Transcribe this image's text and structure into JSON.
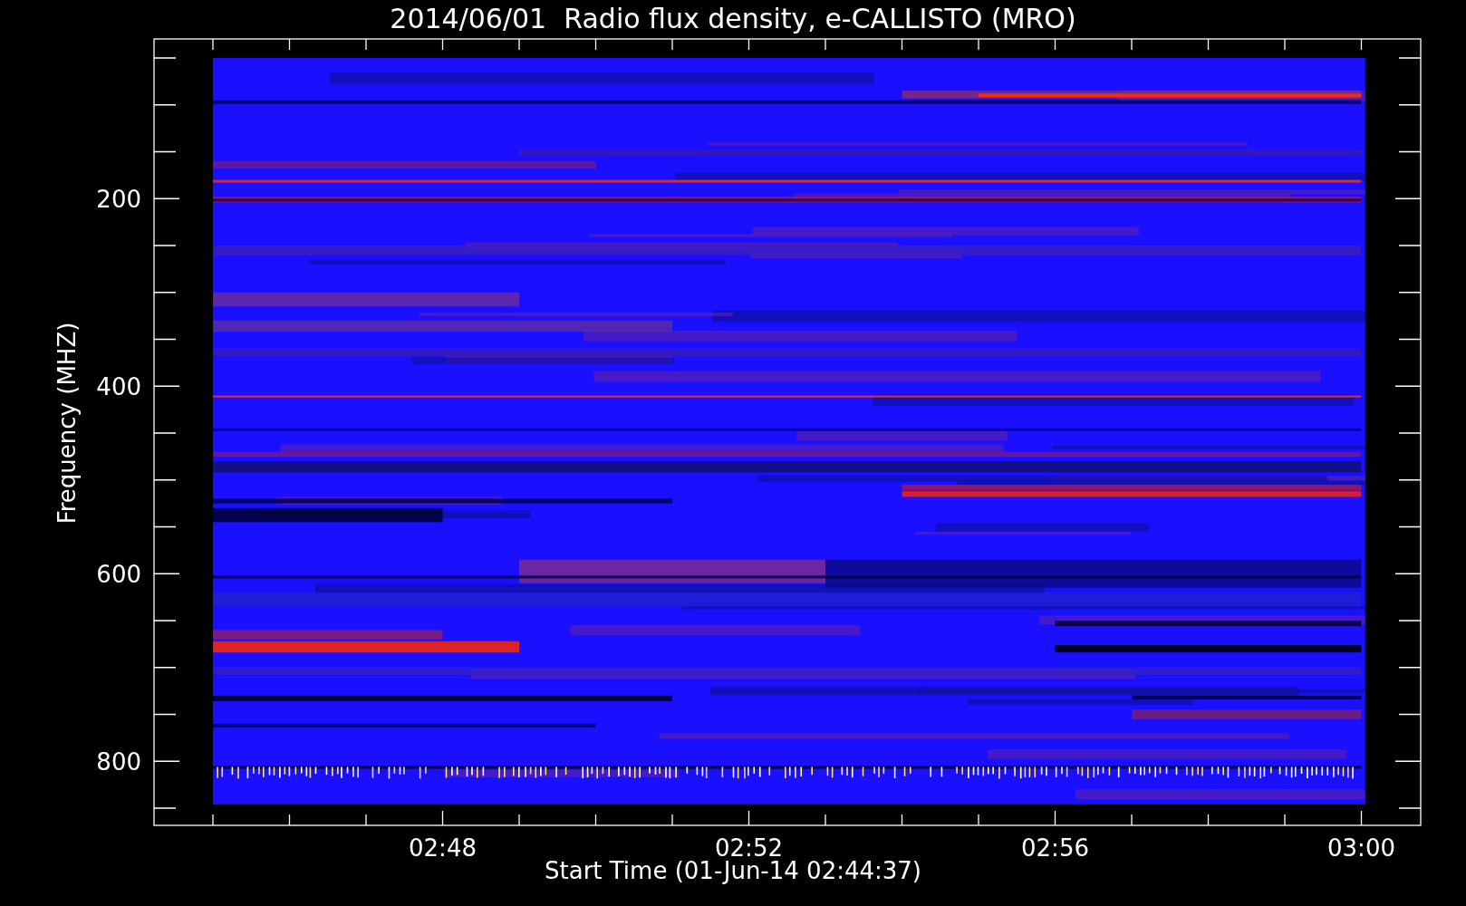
{
  "title": "2014/06/01  Radio flux density, e-CALLISTO (MRO)",
  "y_axis": {
    "label": "Frequency (MHZ)",
    "ticks": [
      "200",
      "400",
      "600",
      "800"
    ]
  },
  "x_axis": {
    "label": "Start Time (01-Jun-14 02:44:37)",
    "ticks": [
      "02:48",
      "02:52",
      "02:56",
      "03:00"
    ]
  }
}
